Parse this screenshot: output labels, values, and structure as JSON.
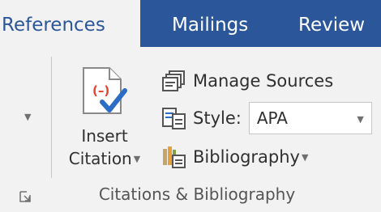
{
  "tabs": {
    "references": "References",
    "mailings": "Mailings",
    "review": "Review"
  },
  "citations_group": {
    "insert_citation_line1": "Insert",
    "insert_citation_line2": "Citation",
    "manage_sources": "Manage Sources",
    "style_label": "Style:",
    "style_value": "APA",
    "bibliography": "Bibliography",
    "group_label": "Citations & Bibliography"
  },
  "icons": {
    "insert_citation": "insert-citation-icon",
    "manage_sources": "manage-sources-icon",
    "style": "style-icon",
    "bibliography": "bibliography-icon",
    "dialog_launcher": "dialog-launcher-icon"
  },
  "colors": {
    "tab_bar": "#2b579a",
    "ribbon": "#f2f2f2",
    "active_tab_text": "#2b579a",
    "citation_red": "#e8412c",
    "checkmark_blue": "#2b6cc4"
  }
}
